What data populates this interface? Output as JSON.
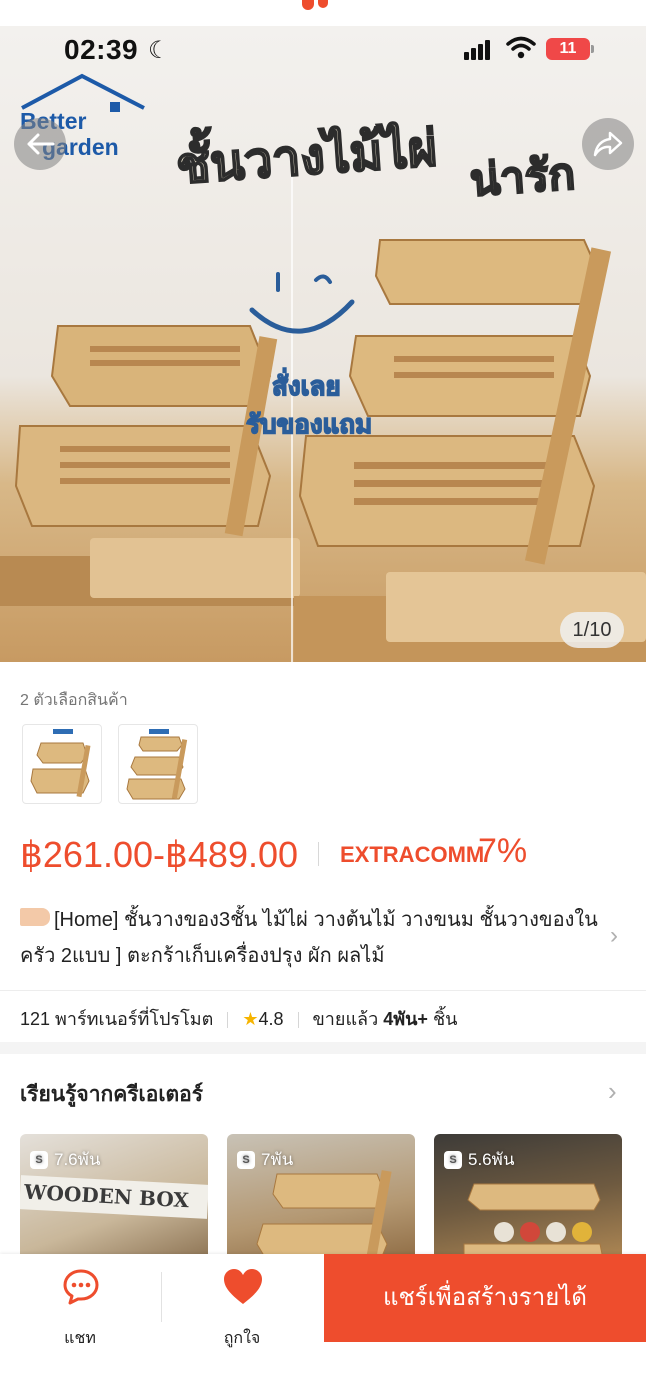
{
  "status_bar": {
    "time": "02:39",
    "battery": "11"
  },
  "hero": {
    "brand_line1": "Better",
    "brand_line2": "garden",
    "headline": "ชั้นวางไม้ไผ่",
    "headline2": "น่ารัก",
    "promo_line1": "สั่งเลย",
    "promo_line2": "รับของแถม",
    "counter": "1/10"
  },
  "variants": {
    "label": "2 ตัวเลือกสินค้า"
  },
  "price": {
    "currency": "฿",
    "range": "฿261.00-฿489.00",
    "extra_label": "EXTRA",
    "comm_label": "COMM",
    "commission": "7%"
  },
  "product": {
    "title": "[Home]  ชั้นวางของ3ชั้น ไม้ไผ่ วางต้นไม้ วางขนม ชั้นวางของในครัว 2แบบ ] ตะกร้าเก็บเครื่องปรุง ผัก ผลไม้"
  },
  "stats": {
    "partners": "121 พาร์ทเนอร์ที่โปรโมต",
    "rating": "4.8",
    "sold_prefix": "ขายแล้ว",
    "sold_value": "4พัน+",
    "sold_unit": "ชิ้น"
  },
  "creators": {
    "title": "เรียนรู้จากครีเอเตอร์",
    "videos": [
      {
        "views": "7.6พัน",
        "caption": "WOODEN BOX"
      },
      {
        "views": "7พัน"
      },
      {
        "views": "5.6พัน"
      }
    ]
  },
  "bottom_bar": {
    "chat_label": "แชท",
    "like_label": "ถูกใจ",
    "share_label": "แชร์เพื่อสร้างรายได้"
  },
  "colors": {
    "accent": "#ee4d2d",
    "brand_blue": "#1d5aa8",
    "star": "#f6b400"
  }
}
